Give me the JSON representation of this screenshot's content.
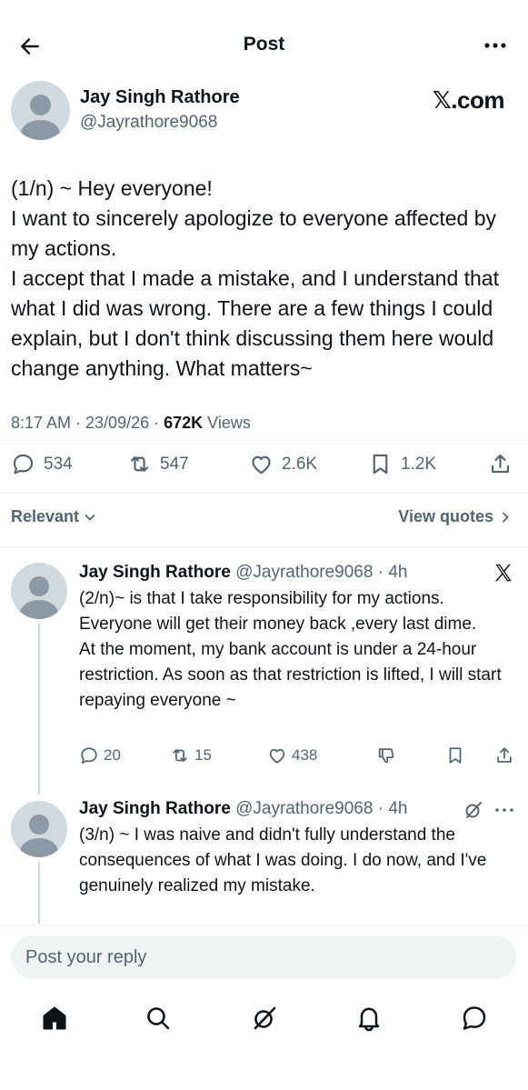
{
  "header": {
    "title": "Post",
    "back_icon": "arrow-left-icon",
    "more_icon": "more-horizontal-icon"
  },
  "main_post": {
    "author_name": "Jay Singh Rathore",
    "author_handle": "@Jayrathore9068",
    "source_badge": "𝕏.com",
    "body_lines": [
      "(1/n) ~ Hey everyone!",
      "I want to sincerely apologize to everyone affected by my actions.",
      "I accept that I made a mistake, and I understand that what I did was wrong. There are a few things I could explain, but I don't think discussing them here would change anything. What matters~"
    ],
    "time": "8:17 AM · 23/09/26 · ",
    "views_count": "672K",
    "views_label": " Views",
    "stats": {
      "replies": "534",
      "reposts": "547",
      "likes": "2.6K",
      "bookmarks": "1.2K"
    }
  },
  "sort": {
    "relevant_label": "Relevant",
    "view_quotes_label": "View quotes"
  },
  "replies": [
    {
      "name": "Jay Singh Rathore",
      "handle_time": " @Jayrathore9068 · 4h",
      "lines": [
        "(2/n)~ is that I take responsibility for my actions. Everyone will get their money back ,every last dime.",
        "At the moment, my bank account is under a 24-hour restriction. As soon as that restriction is lifted, I will start repaying everyone ~"
      ],
      "stats": {
        "replies": "20",
        "reposts": "15",
        "likes": "438"
      }
    },
    {
      "name": "Jay Singh Rathore",
      "handle_time": " @Jayrathore9068 · 4h",
      "lines": [
        "(3/n) ~ I was naive and didn't fully understand the consequences of what I was doing. I do now, and I've genuinely realized my mistake."
      ]
    }
  ],
  "composer": {
    "placeholder": "Post your reply"
  },
  "bottom_nav": [
    "home-icon",
    "search-icon",
    "grok-icon",
    "notifications-icon",
    "messages-icon"
  ],
  "colors": {
    "text": "#0f1419",
    "secondary": "#536471",
    "divider": "#eff3f4",
    "avatar_bg": "#cfd9de"
  }
}
